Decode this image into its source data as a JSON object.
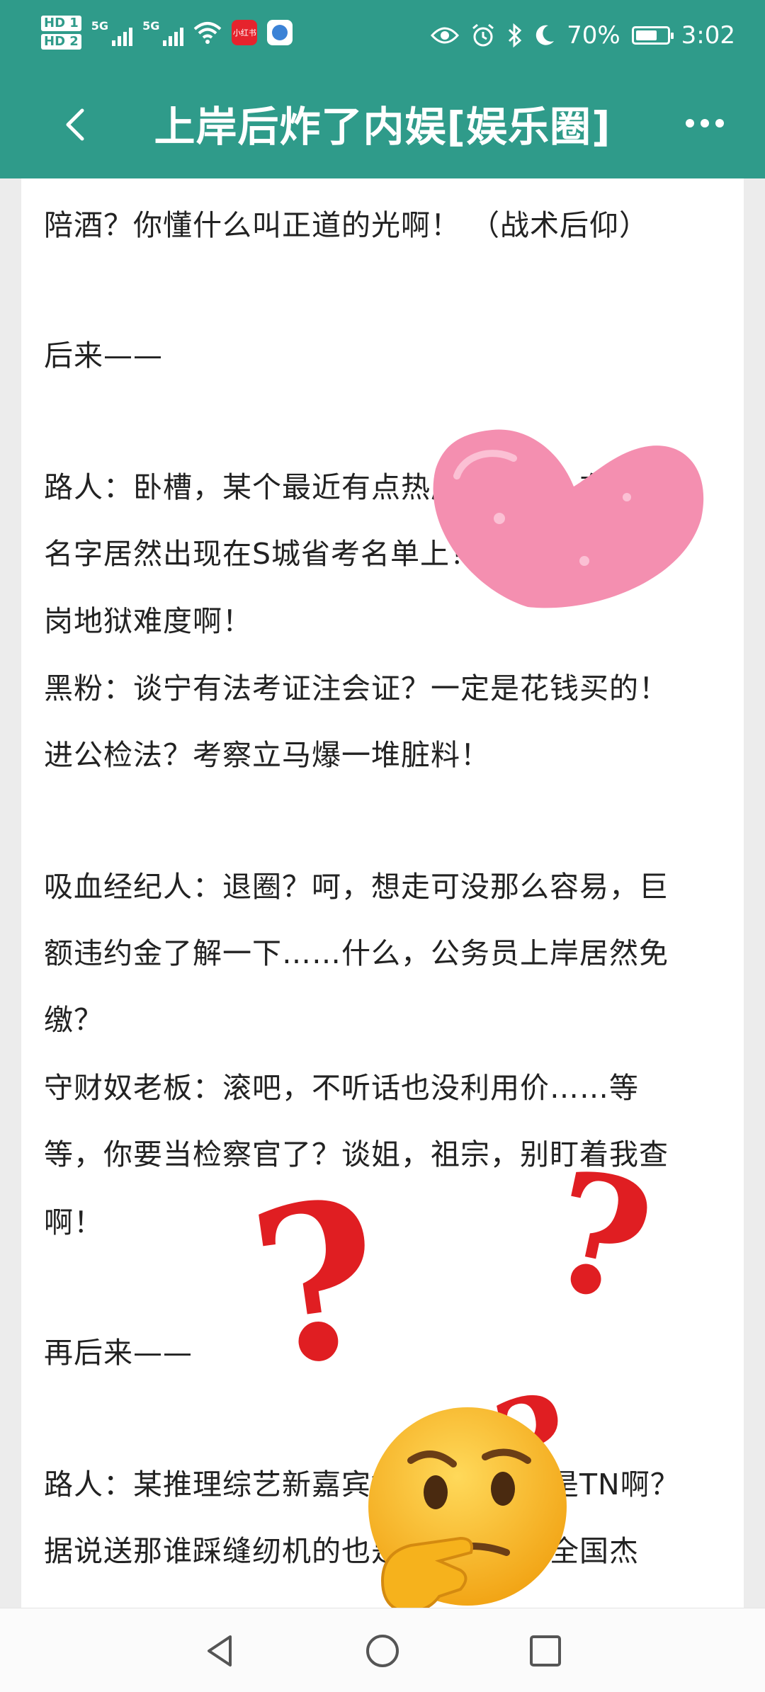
{
  "status_bar": {
    "sim1": "HD 1",
    "sim2": "HD 2",
    "network1": "5G",
    "network2": "5G",
    "app_badge_text": "小红书",
    "battery_text": "70%",
    "battery_level": 0.7,
    "time": "3:02",
    "icons": [
      "eye-icon",
      "alarm-icon",
      "bluetooth-icon",
      "moon-icon"
    ]
  },
  "header": {
    "title": "上岸后炸了内娱[娱乐圈]",
    "back_icon": "chevron-left-icon",
    "more_icon": "more-dots-icon"
  },
  "content": {
    "lines": [
      "陪酒？你懂什么叫正道的光啊！ （战术后仰）",
      "后来——",
      "路人：卧槽，某个最近有点热度的女团，有成员",
      "名字居然出现在S城省考名单上！同名同姓？这",
      "岗地狱难度啊！",
      "黑粉：谈宁有法考证注会证？一定是花钱买的！",
      "进公检法？考察立马爆一堆脏料！",
      "吸血经纪人：退圈？呵，想走可没那么容易，巨",
      "额违约金了解一下……什么，公务员上岸居然免",
      "缴？",
      "守财奴老板：滚吧，不听话也没利用价……等",
      "等，你要当检察官了？谈姐，祖宗，别盯着我查",
      "啊！",
      "再后来——",
      "路人：某推理综艺新嘉宾好眼熟，是不是TN啊？",
      "据说送那谁踩缝纫机的也是她，还当选全国杰"
    ]
  },
  "stickers": [
    "pink-heart-sticker",
    "thinking-face-sticker",
    "red-question-mark"
  ],
  "nav_bar": {
    "buttons": [
      "back-triangle-icon",
      "home-circle-icon",
      "recents-square-icon"
    ]
  },
  "colors": {
    "accent": "#2f9b8a",
    "text": "#222222",
    "heart": "#f48fb0",
    "question": "#e01e22",
    "emoji": "#f6b21c"
  }
}
